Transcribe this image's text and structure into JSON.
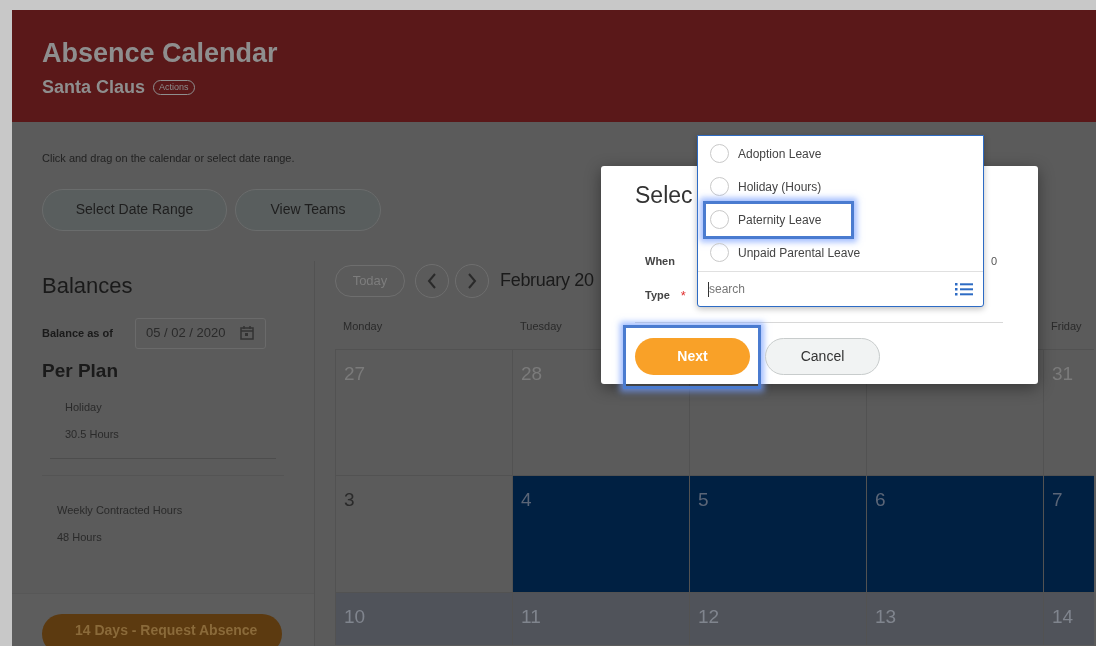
{
  "header": {
    "title": "Absence Calendar",
    "subtitle": "Santa Claus",
    "actions_label": "Actions"
  },
  "instructions": "Click and drag on the calendar or select date range.",
  "toolbar_buttons": [
    "Select Date Range",
    "View Teams"
  ],
  "balances": {
    "title": "Balances",
    "as_of_label": "Balance as of",
    "as_of_value": "05 / 02 / 2020",
    "plan_title": "Per Plan",
    "plans": [
      {
        "name": "Holiday",
        "amount": "30.5 Hours"
      },
      {
        "name": "Weekly Contracted Hours",
        "amount": "48 Hours"
      }
    ],
    "request_button": "14 Days - Request Absence"
  },
  "calendar": {
    "today_button": "Today",
    "month": "February 20",
    "weekdays": [
      "Monday",
      "Tuesday",
      "Friday"
    ],
    "weeks": [
      [
        {
          "day": "27",
          "kind": "other_month"
        },
        {
          "day": "28",
          "kind": "other_month"
        },
        {
          "kind": "normal"
        },
        {
          "kind": "normal"
        },
        {
          "day": "31",
          "kind": "other_month"
        }
      ],
      [
        {
          "day": "3",
          "kind": "normal"
        },
        {
          "day": "4",
          "kind": "selected"
        },
        {
          "day": "5",
          "kind": "selected"
        },
        {
          "day": "6",
          "kind": "selected"
        },
        {
          "day": "7",
          "kind": "selected"
        }
      ],
      [
        {
          "day": "10",
          "kind": "faded"
        },
        {
          "day": "11",
          "kind": "faded"
        },
        {
          "day": "12",
          "kind": "faded"
        },
        {
          "day": "13",
          "kind": "faded"
        },
        {
          "day": "14",
          "kind": "faded"
        }
      ]
    ]
  },
  "dialog": {
    "title": "Selec",
    "when_label": "When",
    "when_value": "0",
    "type_label": "Type",
    "required_mark": "*",
    "buttons": [
      {
        "label": "Next",
        "kind": "primary",
        "highlighted": true
      },
      {
        "label": "Cancel",
        "kind": "secondary",
        "highlighted": false
      }
    ]
  },
  "dropdown": {
    "options": [
      {
        "label": "Adoption Leave",
        "selected": false,
        "highlighted": false
      },
      {
        "label": "Holiday (Hours)",
        "selected": false,
        "highlighted": false
      },
      {
        "label": "Paternity Leave",
        "selected": false,
        "highlighted": true
      },
      {
        "label": "Unpaid Parental Leave",
        "selected": false,
        "highlighted": false
      }
    ],
    "search_placeholder": "search"
  }
}
